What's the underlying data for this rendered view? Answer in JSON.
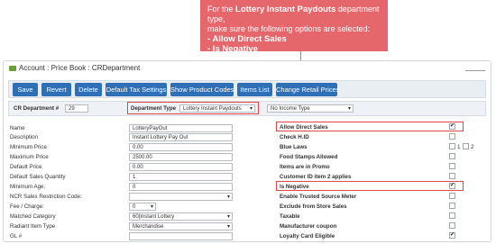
{
  "callout": {
    "line1": "For the",
    "bold1": "Lottery Instant Paydouts",
    "line1b": "department type,",
    "line2": "make sure the following options are selected:",
    "opt1": "- Allow Direct Sales",
    "opt2": "- Is Negative",
    "color": "#e5676b"
  },
  "window": {
    "title": "Account : Price Book : CRDepartment"
  },
  "buttons": [
    "Save",
    "Revert",
    "Delete",
    "Default Tax Settings",
    "Show Product Codes",
    "Items List",
    "Change Retail Prices"
  ],
  "filter": {
    "dept_label": "CR Department #",
    "dept_value": "29",
    "type_label": "Department Type",
    "type_value": "Lottery Instant Paydouts",
    "income_value": "No Income Type"
  },
  "left_fields": [
    {
      "label": "Name",
      "value": "LotteryPayOut"
    },
    {
      "label": "Description",
      "value": "Instant Lottery Pay Out"
    },
    {
      "label": "Minimum Price",
      "value": "0.00"
    },
    {
      "label": "Maximum Price",
      "value": "2500.00"
    },
    {
      "label": "Default Price",
      "value": "0.00"
    },
    {
      "label": "Default Sales Quantity",
      "value": "1"
    },
    {
      "label": "Minimum Age:",
      "value": "0"
    },
    {
      "label": "NCR Sales Restriction Code:",
      "value": ""
    },
    {
      "label": "Fee / Charge:",
      "value": "0"
    },
    {
      "label": "Matched Category",
      "value": "60|Instant Lottery"
    },
    {
      "label": "Radiant Item Type",
      "value": "Merchandise"
    },
    {
      "label": "GL #",
      "value": ""
    }
  ],
  "right_fields": [
    {
      "label": "Allow Direct Sales",
      "checked": true
    },
    {
      "label": "Check H.ID",
      "checked": false
    },
    {
      "label": "Blue Laws",
      "checked": false
    },
    {
      "label": "Food Stamps Allowed",
      "checked": false
    },
    {
      "label": "Items are in Promo",
      "checked": false
    },
    {
      "label": "Customer ID item 2 applies",
      "checked": false
    },
    {
      "label": "Is Negative",
      "checked": true
    },
    {
      "label": "Enable Trusted Source Meter",
      "checked": false
    },
    {
      "label": "Exclude from Store Sales",
      "checked": false
    },
    {
      "label": "Taxable",
      "checked": false
    },
    {
      "label": "Manufacturer coupon",
      "checked": false
    },
    {
      "label": "Loyalty Card Eligible",
      "checked": true
    }
  ],
  "blue_laws_options": [
    "1",
    "2"
  ],
  "check_mark": "✔"
}
